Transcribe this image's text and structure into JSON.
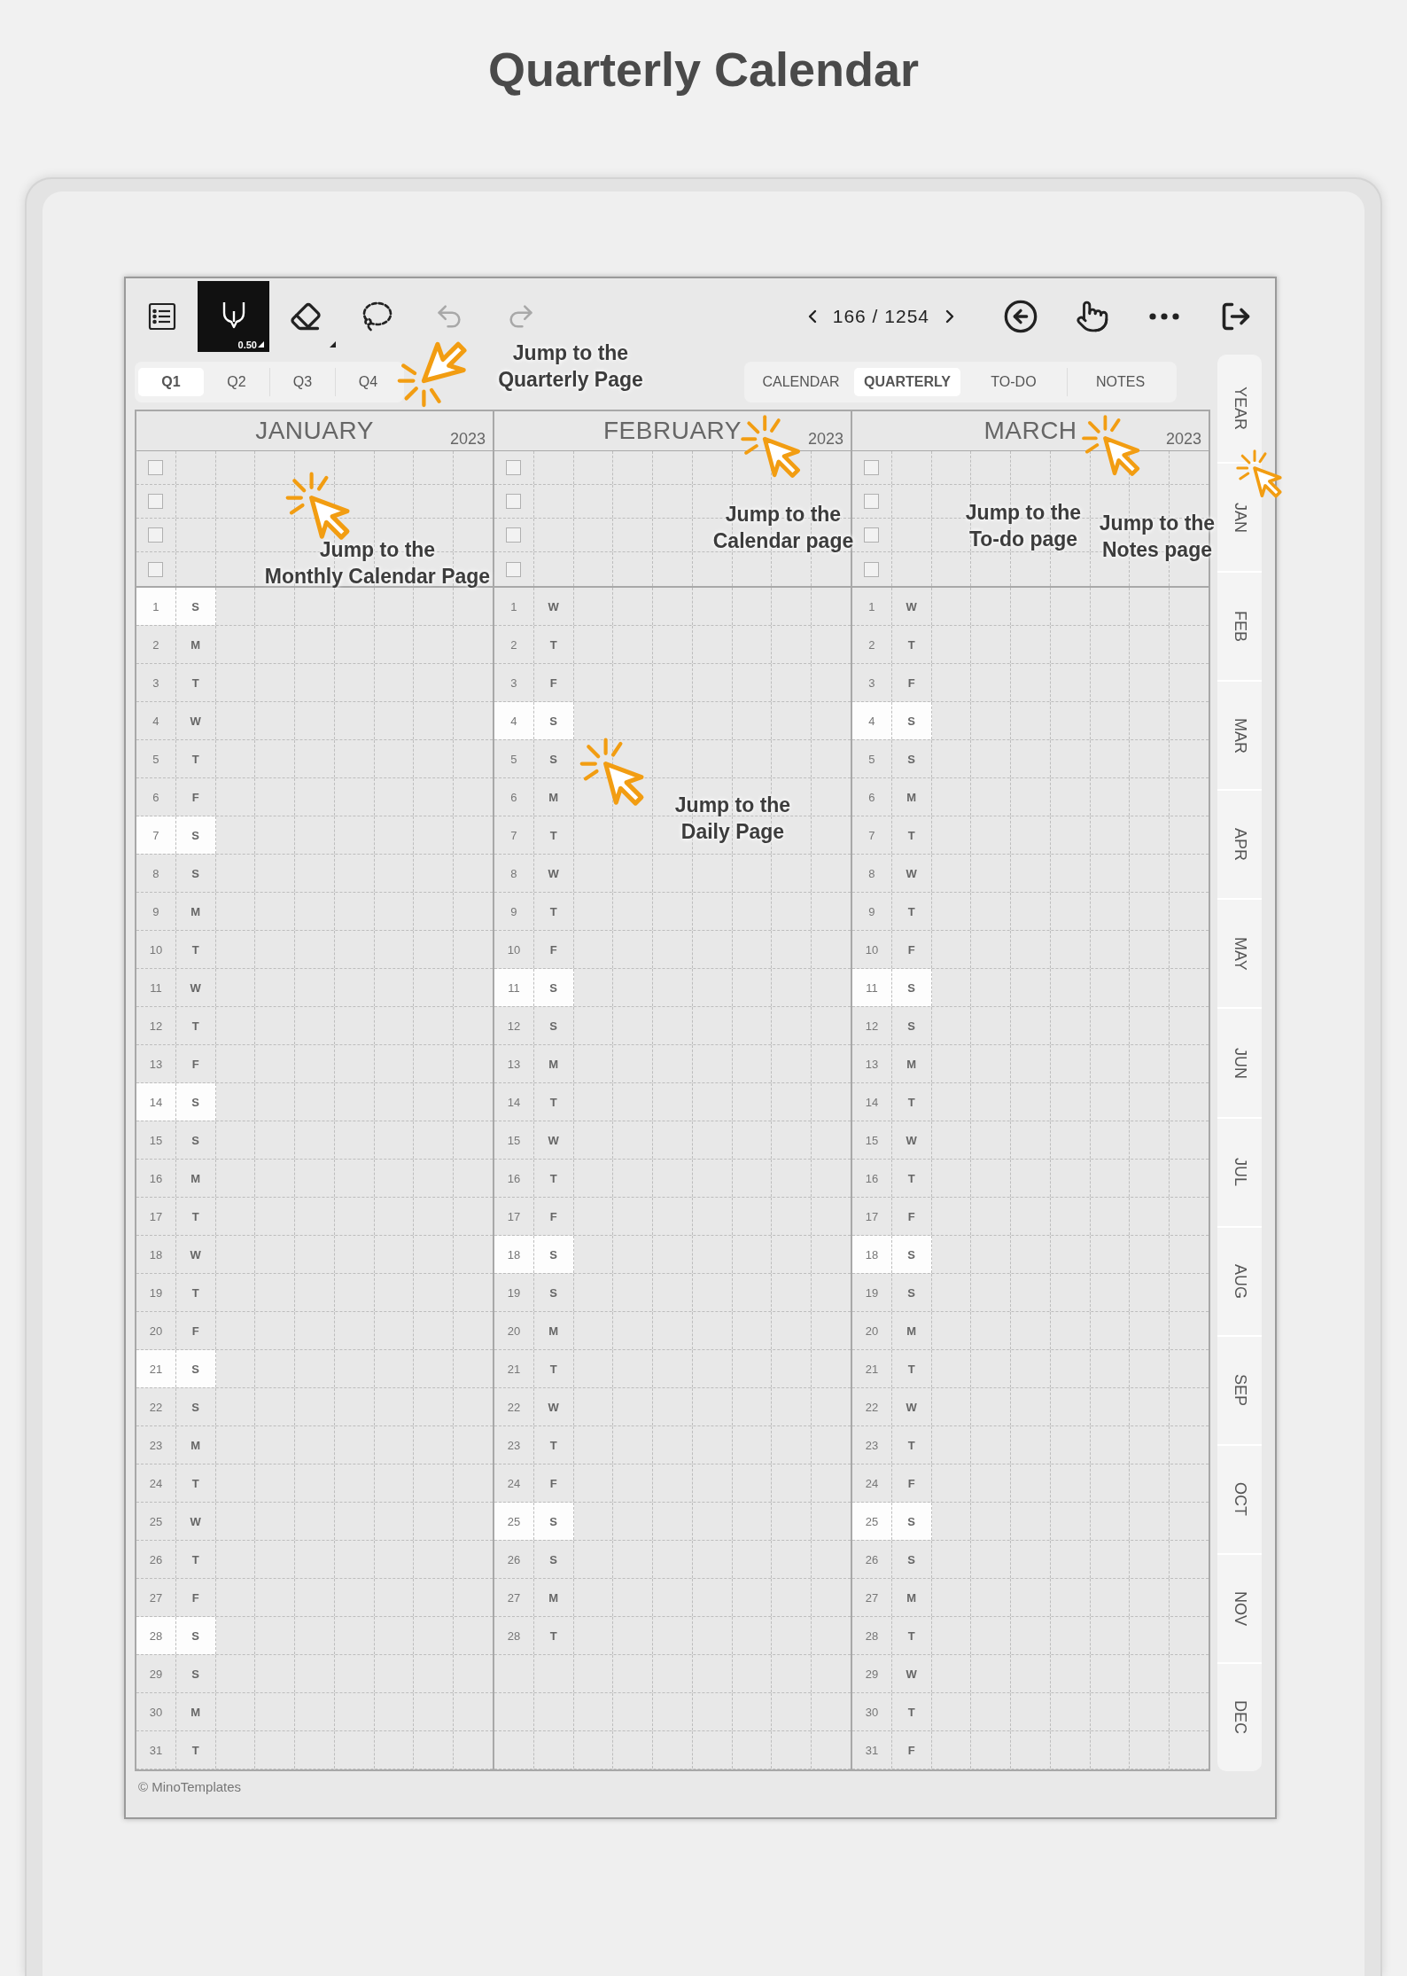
{
  "title": "Quarterly Calendar",
  "toolbar": {
    "tools": [
      {
        "kind": "menu"
      },
      {
        "kind": "pen",
        "selected": true,
        "size": "0.50"
      },
      {
        "kind": "eraser",
        "selected": false
      },
      {
        "kind": "lasso",
        "selected": false
      },
      {
        "kind": "undo",
        "disabled": true
      },
      {
        "kind": "redo",
        "disabled": true
      }
    ],
    "page": "166 / 1254",
    "actions": [
      {
        "kind": "return"
      },
      {
        "kind": "swipe"
      },
      {
        "kind": "more"
      },
      {
        "kind": "exit"
      }
    ]
  },
  "quarter_tabs": [
    {
      "label": "Q1",
      "selected": true
    },
    {
      "label": "Q2",
      "selected": false
    },
    {
      "label": "Q3",
      "selected": false
    },
    {
      "label": "Q4",
      "selected": false
    }
  ],
  "view_tabs": [
    {
      "label": "CALENDAR",
      "selected": false
    },
    {
      "label": "QUARTERLY",
      "selected": true
    },
    {
      "label": "TO-DO",
      "selected": false
    },
    {
      "label": "NOTES",
      "selected": false
    }
  ],
  "months": [
    {
      "name": "JANUARY",
      "year": "2023",
      "tasks": [
        {
          "checked": false
        },
        {
          "checked": false
        },
        {
          "checked": false
        },
        {
          "checked": false
        }
      ],
      "days": [
        {
          "day": "1",
          "weekday": "S",
          "highlighted": true
        },
        {
          "day": "2",
          "weekday": "M",
          "highlighted": false
        },
        {
          "day": "3",
          "weekday": "T",
          "highlighted": false
        },
        {
          "day": "4",
          "weekday": "W",
          "highlighted": false
        },
        {
          "day": "5",
          "weekday": "T",
          "highlighted": false
        },
        {
          "day": "6",
          "weekday": "F",
          "highlighted": false
        },
        {
          "day": "7",
          "weekday": "S",
          "highlighted": true
        },
        {
          "day": "8",
          "weekday": "S",
          "highlighted": false
        },
        {
          "day": "9",
          "weekday": "M",
          "highlighted": false
        },
        {
          "day": "10",
          "weekday": "T",
          "highlighted": false
        },
        {
          "day": "11",
          "weekday": "W",
          "highlighted": false
        },
        {
          "day": "12",
          "weekday": "T",
          "highlighted": false
        },
        {
          "day": "13",
          "weekday": "F",
          "highlighted": false
        },
        {
          "day": "14",
          "weekday": "S",
          "highlighted": true
        },
        {
          "day": "15",
          "weekday": "S",
          "highlighted": false
        },
        {
          "day": "16",
          "weekday": "M",
          "highlighted": false
        },
        {
          "day": "17",
          "weekday": "T",
          "highlighted": false
        },
        {
          "day": "18",
          "weekday": "W",
          "highlighted": false
        },
        {
          "day": "19",
          "weekday": "T",
          "highlighted": false
        },
        {
          "day": "20",
          "weekday": "F",
          "highlighted": false
        },
        {
          "day": "21",
          "weekday": "S",
          "highlighted": true
        },
        {
          "day": "22",
          "weekday": "S",
          "highlighted": false
        },
        {
          "day": "23",
          "weekday": "M",
          "highlighted": false
        },
        {
          "day": "24",
          "weekday": "T",
          "highlighted": false
        },
        {
          "day": "25",
          "weekday": "W",
          "highlighted": false
        },
        {
          "day": "26",
          "weekday": "T",
          "highlighted": false
        },
        {
          "day": "27",
          "weekday": "F",
          "highlighted": false
        },
        {
          "day": "28",
          "weekday": "S",
          "highlighted": true
        },
        {
          "day": "29",
          "weekday": "S",
          "highlighted": false
        },
        {
          "day": "30",
          "weekday": "M",
          "highlighted": false
        },
        {
          "day": "31",
          "weekday": "T",
          "highlighted": false
        }
      ]
    },
    {
      "name": "FEBRUARY",
      "year": "2023",
      "tasks": [
        {
          "checked": false
        },
        {
          "checked": false
        },
        {
          "checked": false
        },
        {
          "checked": false
        }
      ],
      "days": [
        {
          "day": "1",
          "weekday": "W",
          "highlighted": false
        },
        {
          "day": "2",
          "weekday": "T",
          "highlighted": false
        },
        {
          "day": "3",
          "weekday": "F",
          "highlighted": false
        },
        {
          "day": "4",
          "weekday": "S",
          "highlighted": true
        },
        {
          "day": "5",
          "weekday": "S",
          "highlighted": false
        },
        {
          "day": "6",
          "weekday": "M",
          "highlighted": false
        },
        {
          "day": "7",
          "weekday": "T",
          "highlighted": false
        },
        {
          "day": "8",
          "weekday": "W",
          "highlighted": false
        },
        {
          "day": "9",
          "weekday": "T",
          "highlighted": false
        },
        {
          "day": "10",
          "weekday": "F",
          "highlighted": false
        },
        {
          "day": "11",
          "weekday": "S",
          "highlighted": true
        },
        {
          "day": "12",
          "weekday": "S",
          "highlighted": false
        },
        {
          "day": "13",
          "weekday": "M",
          "highlighted": false
        },
        {
          "day": "14",
          "weekday": "T",
          "highlighted": false
        },
        {
          "day": "15",
          "weekday": "W",
          "highlighted": false
        },
        {
          "day": "16",
          "weekday": "T",
          "highlighted": false
        },
        {
          "day": "17",
          "weekday": "F",
          "highlighted": false
        },
        {
          "day": "18",
          "weekday": "S",
          "highlighted": true
        },
        {
          "day": "19",
          "weekday": "S",
          "highlighted": false
        },
        {
          "day": "20",
          "weekday": "M",
          "highlighted": false
        },
        {
          "day": "21",
          "weekday": "T",
          "highlighted": false
        },
        {
          "day": "22",
          "weekday": "W",
          "highlighted": false
        },
        {
          "day": "23",
          "weekday": "T",
          "highlighted": false
        },
        {
          "day": "24",
          "weekday": "F",
          "highlighted": false
        },
        {
          "day": "25",
          "weekday": "S",
          "highlighted": true
        },
        {
          "day": "26",
          "weekday": "S",
          "highlighted": false
        },
        {
          "day": "27",
          "weekday": "M",
          "highlighted": false
        },
        {
          "day": "28",
          "weekday": "T",
          "highlighted": false
        }
      ]
    },
    {
      "name": "MARCH",
      "year": "2023",
      "tasks": [
        {
          "checked": false
        },
        {
          "checked": false
        },
        {
          "checked": false
        },
        {
          "checked": false
        }
      ],
      "days": [
        {
          "day": "1",
          "weekday": "W",
          "highlighted": false
        },
        {
          "day": "2",
          "weekday": "T",
          "highlighted": false
        },
        {
          "day": "3",
          "weekday": "F",
          "highlighted": false
        },
        {
          "day": "4",
          "weekday": "S",
          "highlighted": true
        },
        {
          "day": "5",
          "weekday": "S",
          "highlighted": false
        },
        {
          "day": "6",
          "weekday": "M",
          "highlighted": false
        },
        {
          "day": "7",
          "weekday": "T",
          "highlighted": false
        },
        {
          "day": "8",
          "weekday": "W",
          "highlighted": false
        },
        {
          "day": "9",
          "weekday": "T",
          "highlighted": false
        },
        {
          "day": "10",
          "weekday": "F",
          "highlighted": false
        },
        {
          "day": "11",
          "weekday": "S",
          "highlighted": true
        },
        {
          "day": "12",
          "weekday": "S",
          "highlighted": false
        },
        {
          "day": "13",
          "weekday": "M",
          "highlighted": false
        },
        {
          "day": "14",
          "weekday": "T",
          "highlighted": false
        },
        {
          "day": "15",
          "weekday": "W",
          "highlighted": false
        },
        {
          "day": "16",
          "weekday": "T",
          "highlighted": false
        },
        {
          "day": "17",
          "weekday": "F",
          "highlighted": false
        },
        {
          "day": "18",
          "weekday": "S",
          "highlighted": true
        },
        {
          "day": "19",
          "weekday": "S",
          "highlighted": false
        },
        {
          "day": "20",
          "weekday": "M",
          "highlighted": false
        },
        {
          "day": "21",
          "weekday": "T",
          "highlighted": false
        },
        {
          "day": "22",
          "weekday": "W",
          "highlighted": false
        },
        {
          "day": "23",
          "weekday": "T",
          "highlighted": false
        },
        {
          "day": "24",
          "weekday": "F",
          "highlighted": false
        },
        {
          "day": "25",
          "weekday": "S",
          "highlighted": true
        },
        {
          "day": "26",
          "weekday": "S",
          "highlighted": false
        },
        {
          "day": "27",
          "weekday": "M",
          "highlighted": false
        },
        {
          "day": "28",
          "weekday": "T",
          "highlighted": false
        },
        {
          "day": "29",
          "weekday": "W",
          "highlighted": false
        },
        {
          "day": "30",
          "weekday": "T",
          "highlighted": false
        },
        {
          "day": "31",
          "weekday": "F",
          "highlighted": false
        }
      ]
    }
  ],
  "month_sidebar": [
    "YEAR",
    "JAN",
    "FEB",
    "MAR",
    "APR",
    "MAY",
    "JUN",
    "JUL",
    "AUG",
    "SEP",
    "OCT",
    "NOV",
    "DEC"
  ],
  "footer": "© MinoTemplates",
  "annotations": [
    {
      "text": "Jump to the\nQuarterly Page"
    },
    {
      "text": "Jump to the\nMonthly Calendar Page"
    },
    {
      "text": "Jump to the\nCalendar page"
    },
    {
      "text": "Jump to the\nTo-do page"
    },
    {
      "text": "Jump to the\nNotes page"
    },
    {
      "text": "Jump to the\nDaily Page"
    }
  ]
}
